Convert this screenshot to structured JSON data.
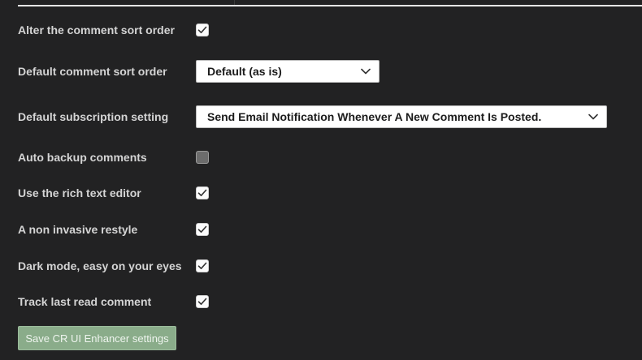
{
  "settings": [
    {
      "label": "Alter the comment sort order",
      "type": "checkbox",
      "checked": true
    },
    {
      "label": "Default comment sort order",
      "type": "select",
      "value": "Default (as is)"
    },
    {
      "label": "Default subscription setting",
      "type": "select",
      "value": "Send Email Notification Whenever A New Comment Is Posted."
    },
    {
      "label": "Auto backup comments",
      "type": "checkbox",
      "checked": false
    },
    {
      "label": "Use the rich text editor",
      "type": "checkbox",
      "checked": true
    },
    {
      "label": "A non invasive restyle",
      "type": "checkbox",
      "checked": true
    },
    {
      "label": "Dark mode, easy on your eyes",
      "type": "checkbox",
      "checked": true
    },
    {
      "label": "Track last read comment",
      "type": "checkbox",
      "checked": true
    }
  ],
  "save_button": {
    "label": "Save CR UI Enhancer settings"
  },
  "colors": {
    "background": "#222223",
    "label_text": "#d4d4d4",
    "save_button_bg": "#8aac8a",
    "checkmark": "#333333"
  }
}
